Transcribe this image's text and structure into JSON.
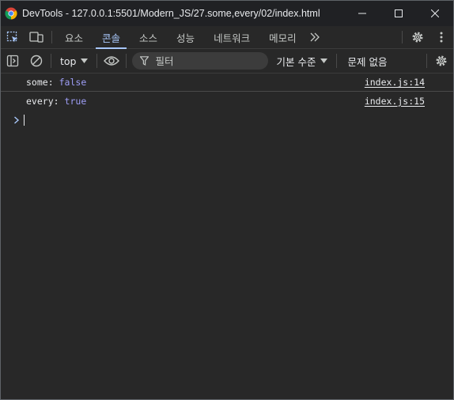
{
  "window": {
    "title": "DevTools - 127.0.0.1:5501/Modern_JS/27.some,every/02/index.html",
    "controls": [
      "minimize-icon",
      "maximize-icon",
      "close-icon"
    ]
  },
  "tabs": {
    "items": [
      {
        "label": "요소",
        "active": false
      },
      {
        "label": "콘솔",
        "active": true
      },
      {
        "label": "소스",
        "active": false
      },
      {
        "label": "성능",
        "active": false
      },
      {
        "label": "네트워크",
        "active": false
      },
      {
        "label": "메모리",
        "active": false
      }
    ],
    "more_icon": "chevrons-right-icon",
    "accent": "#a8c7fa"
  },
  "toolbar": {
    "context": "top",
    "filter_placeholder": "필터",
    "level": "기본 수준",
    "issues": "문제 없음"
  },
  "console": {
    "messages": [
      {
        "key": "some:",
        "value": "false",
        "source": "index.js:14"
      },
      {
        "key": "every:",
        "value": "true",
        "source": "index.js:15"
      }
    ],
    "value_color": "#9e9ef7"
  }
}
